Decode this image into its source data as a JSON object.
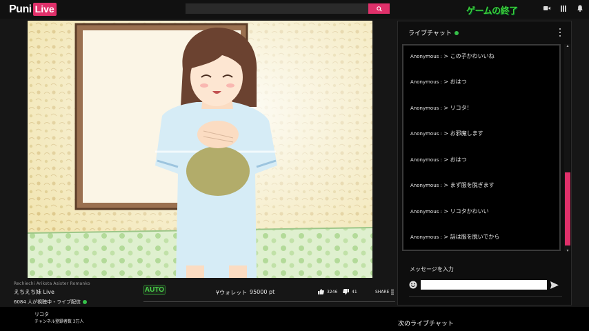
{
  "header": {
    "logo_puni": "Puni",
    "logo_live": "Live",
    "end_game": "ゲームの終了",
    "icons": [
      "video-camera-icon",
      "library-icon",
      "bell-icon"
    ]
  },
  "stream": {
    "tag": "Rechiechi Arikota Asister Romanko",
    "title": "えちえち妹 Live",
    "viewers": "6084 人が視聴中・ライブ配信"
  },
  "controls": {
    "auto": "AUTO",
    "wallet_label": "¥ウォレット",
    "wallet_value": "95000 pt",
    "likes": "3246",
    "dislikes": "41",
    "share": "SHARE"
  },
  "chat": {
    "header": "ライブチャット",
    "input_label": "メッセージを入力",
    "messages": [
      {
        "user": "Anonymous :",
        "text": "> この子かわいいね"
      },
      {
        "user": "Anonymous :",
        "text": "> おはつ"
      },
      {
        "user": "Anonymous :",
        "text": "> リコタ！"
      },
      {
        "user": "Anonymous :",
        "text": "> お邪魔します"
      },
      {
        "user": "Anonymous :",
        "text": "> おはつ"
      },
      {
        "user": "Anonymous :",
        "text": "> まず服を脱ぎます"
      },
      {
        "user": "Anonymous :",
        "text": "> リコタかわいい"
      },
      {
        "user": "Anonymous :",
        "text": "> 話は服を脱いでから"
      }
    ]
  },
  "channel": {
    "name": "リコタ",
    "subscribers": "チャンネル登録者数 3万人"
  },
  "next_chat": "次のライブチャット",
  "colors": {
    "accent": "#e0306a",
    "live_green": "#36c04a",
    "end_game_green": "#3bd13b"
  }
}
